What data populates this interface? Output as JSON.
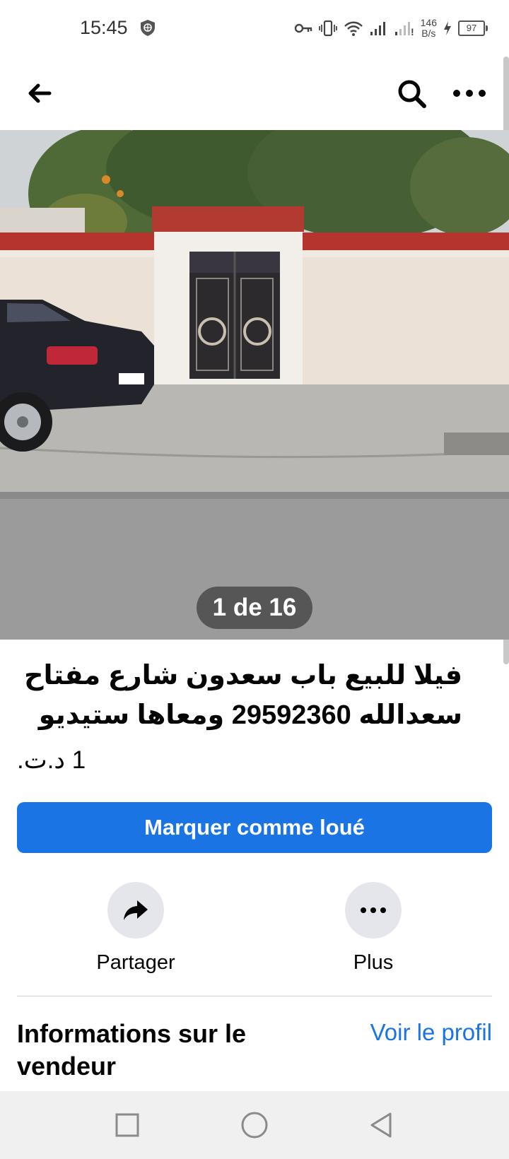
{
  "status_bar": {
    "time": "15:45",
    "net_speed_value": "146",
    "net_speed_unit": "B/s",
    "battery": "97"
  },
  "top_bar": {
    "icons": [
      "back-arrow-icon",
      "search-icon",
      "more-dots-icon"
    ]
  },
  "photo": {
    "counter": "1 de 16"
  },
  "listing": {
    "title": "فيلا للبيع  باب سعدون شارع مفتاح سعدالله 29592360 ومعاها ستيديو",
    "price": "1 د.ت."
  },
  "primary_action": {
    "label": "Marquer comme loué"
  },
  "actions": [
    {
      "label": "Partager",
      "icon": "share-arrow-icon"
    },
    {
      "label": "Plus",
      "icon": "more-dots-icon"
    }
  ],
  "seller": {
    "heading": "Informations sur le vendeur",
    "profile_link": "Voir le profil"
  },
  "colors": {
    "accent": "#1b74e4",
    "text": "#050505",
    "action_bg": "#e4e6eb"
  },
  "nav_bar": {
    "icons": [
      "recents-square-icon",
      "home-circle-icon",
      "back-triangle-icon"
    ]
  }
}
